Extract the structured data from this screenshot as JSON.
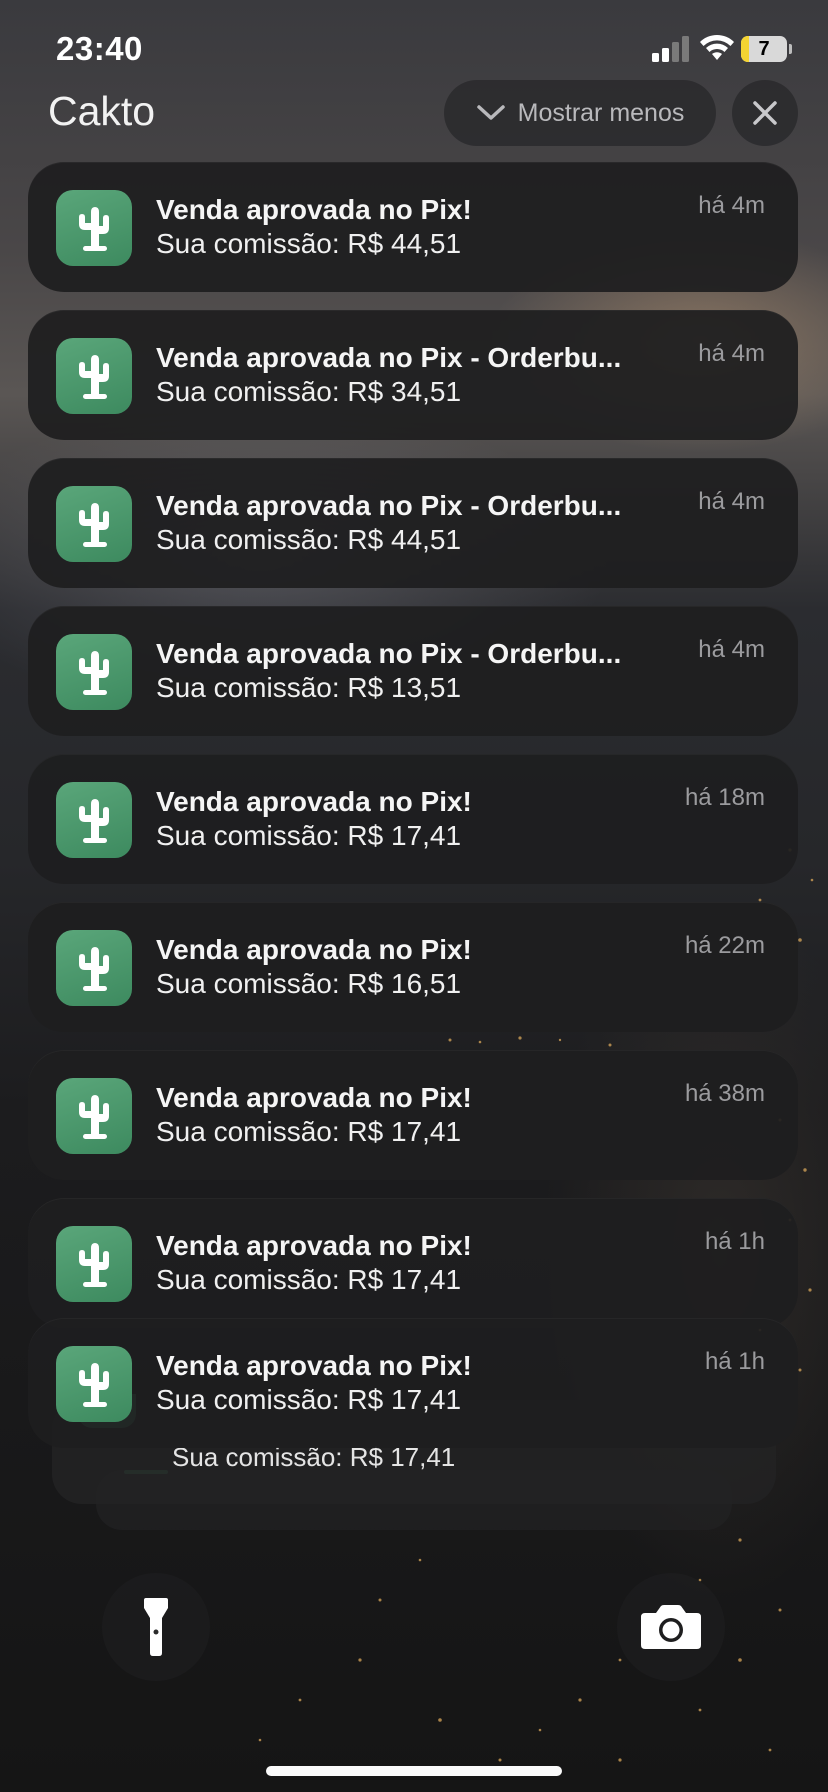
{
  "status_bar": {
    "time": "23:40",
    "battery_level": "7",
    "battery_color": "#f4d432"
  },
  "header": {
    "app_name": "Cakto",
    "show_less_label": "Mostrar menos"
  },
  "notifications": [
    {
      "title": "Venda aprovada no Pix!",
      "body": "Sua comissão: R$ 44,51",
      "time": "há 4m"
    },
    {
      "title": "Venda aprovada no Pix - Orderbu...",
      "body": "Sua comissão: R$ 34,51",
      "time": "há 4m"
    },
    {
      "title": "Venda aprovada no Pix - Orderbu...",
      "body": "Sua comissão: R$ 44,51",
      "time": "há 4m"
    },
    {
      "title": "Venda aprovada no Pix - Orderbu...",
      "body": "Sua comissão: R$ 13,51",
      "time": "há 4m"
    },
    {
      "title": "Venda aprovada no Pix!",
      "body": "Sua comissão: R$ 17,41",
      "time": "há 18m"
    },
    {
      "title": "Venda aprovada no Pix!",
      "body": "Sua comissão: R$ 16,51",
      "time": "há 22m"
    },
    {
      "title": "Venda aprovada no Pix!",
      "body": "Sua comissão: R$ 17,41",
      "time": "há 38m"
    },
    {
      "title": "Venda aprovada no Pix!",
      "body": "Sua comissão: R$ 17,41",
      "time": "há 1h"
    },
    {
      "title": "Venda aprovada no Pix!",
      "body": "Sua comissão: R$ 17,41",
      "time": "há 1h"
    }
  ],
  "stacked_peek": {
    "body": "Sua comissão: R$ 17,41"
  },
  "icons": {
    "app": "cactus-icon",
    "show_less": "chevron-down-icon",
    "close": "close-icon",
    "flashlight": "flashlight-icon",
    "camera": "camera-icon"
  },
  "colors": {
    "app_icon_green": "#4a9a6c",
    "card_background": "#1e1e1f"
  }
}
